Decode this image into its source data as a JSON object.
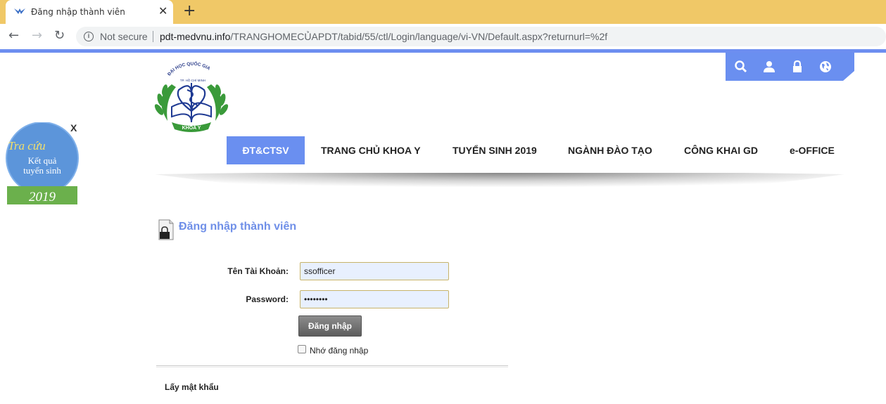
{
  "browser": {
    "tab_title": "Đăng nhập thành viên",
    "security": "Not secure",
    "url_host": "pdt-medvnu.info",
    "url_path": "/TRANGHOMECỦAPDT/tabid/55/ctl/Login/language/vi-VN/Default.aspx?returnurl=%2f"
  },
  "logo": {
    "arc_text": "ĐẠI HỌC QUỐC GIA",
    "arc_text2": "TP. HỒ CHÍ MINH",
    "ribbon": "KHOA Y"
  },
  "badge": {
    "close": "X",
    "line1": "Tra cứu",
    "line2": "Kết quả",
    "line3": "tuyển sinh",
    "year": "2019"
  },
  "menu": {
    "items": [
      {
        "label": "ĐT&CTSV",
        "active": true
      },
      {
        "label": "TRANG CHỦ KHOA Y"
      },
      {
        "label": "TUYỂN SINH 2019"
      },
      {
        "label": "NGÀNH ĐÀO TẠO"
      },
      {
        "label": "CÔNG KHAI GD"
      },
      {
        "label": "e-OFFICE"
      }
    ]
  },
  "login": {
    "title": "Đăng nhập thành viên",
    "username_label": "Tên Tài Khoản:",
    "username_value": "ssofficer",
    "password_label": "Password:",
    "password_value": "••••••••",
    "submit": "Đăng nhập",
    "remember": "Nhớ đăng nhập",
    "forgot": "Lấy mật khẩu"
  },
  "colors": {
    "accent": "#6a8ff0",
    "tab_strip": "#f0c867",
    "badge_green": "#6bb04c",
    "logo_green": "#3a9a3a"
  }
}
